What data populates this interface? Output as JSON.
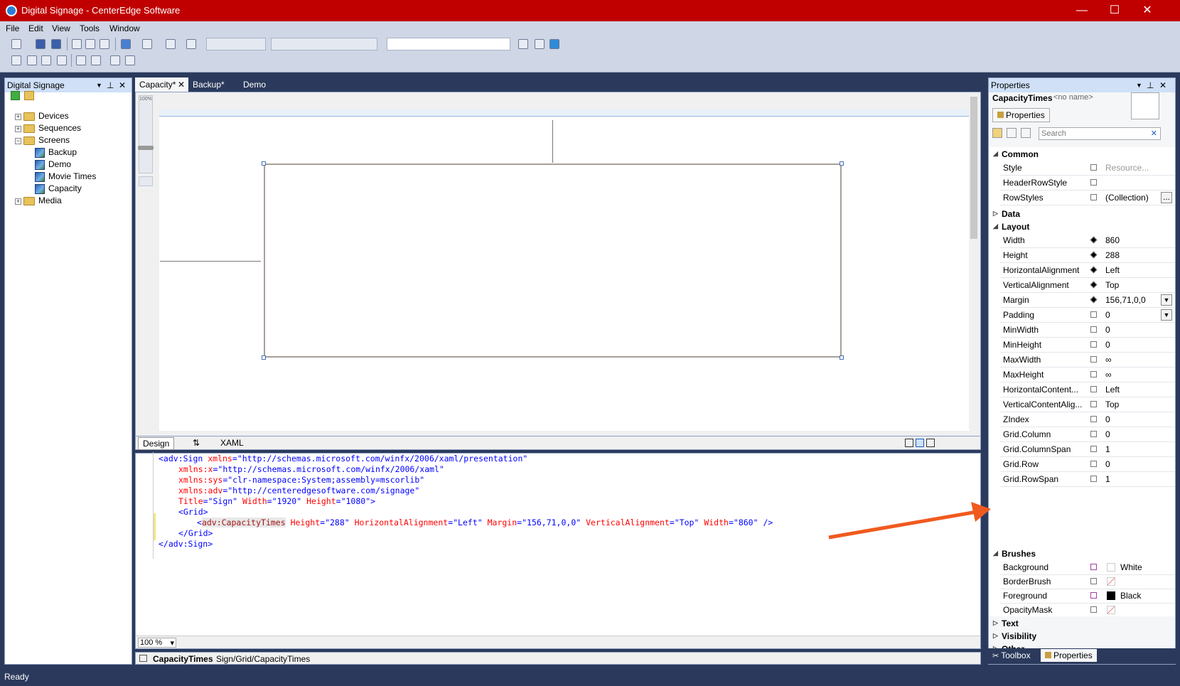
{
  "window": {
    "title": "Digital Signage - CenterEdge Software",
    "min_glyph": "—",
    "max_glyph": "☐",
    "close_glyph": "✕"
  },
  "menu": [
    "File",
    "Edit",
    "View",
    "Tools",
    "Window"
  ],
  "left_panel": {
    "title": "Digital Signage",
    "tree": [
      {
        "label": "Devices",
        "expander": "+"
      },
      {
        "label": "Sequences",
        "expander": "+"
      },
      {
        "label": "Screens",
        "expander": "−"
      },
      {
        "label": "Backup"
      },
      {
        "label": "Demo"
      },
      {
        "label": "Movie Times"
      },
      {
        "label": "Capacity"
      },
      {
        "label": "Media",
        "expander": "+"
      }
    ]
  },
  "tabs": [
    {
      "label": "Capacity*",
      "close": "✕"
    },
    {
      "label": "Backup*"
    },
    {
      "label": "Demo"
    }
  ],
  "designer": {
    "zoom_chip": "100%"
  },
  "editor_tabs": {
    "design": "Design",
    "swap": "⇅",
    "xaml": "XAML"
  },
  "xaml": {
    "line1": {
      "tag": "<adv:Sign",
      "attr": "xmlns",
      "eq": "=",
      "val": "\"http://schemas.microsoft.com/winfx/2006/xaml/presentation\""
    },
    "line2": {
      "attr": "xmlns:x",
      "eq": "=",
      "val": "\"http://schemas.microsoft.com/winfx/2006/xaml\""
    },
    "line3": {
      "attr": "xmlns:sys",
      "eq": "=",
      "val": "\"clr-namespace:System;assembly=mscorlib\""
    },
    "line4": {
      "attr": "xmlns:adv",
      "eq": "=",
      "val": "\"http://centeredgesoftware.com/signage\""
    },
    "line5": {
      "attr1": "Title",
      "val1": "\"Sign\"",
      "attr2": "Width",
      "val2": "\"1920\"",
      "attr3": "Height",
      "val3": "\"1080\"",
      "close": ">"
    },
    "line6": {
      "tag": "<Grid>"
    },
    "line7": {
      "open": "<",
      "tag": "adv:CapacityTimes",
      "a1": "Height",
      "v1": "\"288\"",
      "a2": "HorizontalAlignment",
      "v2": "\"Left\"",
      "a3": "Margin",
      "v3": "\"156,71,0,0\"",
      "a4": "VerticalAlignment",
      "v4": "\"Top\"",
      "a5": "Width",
      "v5": "\"860\"",
      "close": " />"
    },
    "line8": {
      "tag": "</Grid>"
    },
    "line9": {
      "tag": "</adv:Sign>"
    }
  },
  "zoom": {
    "value": "100 %",
    "arrow": "▾"
  },
  "breadcrumb": {
    "element": "CapacityTimes",
    "path": "Sign/Grid/CapacityTimes"
  },
  "properties": {
    "title": "Properties",
    "element_name": "CapacityTimes",
    "no_name": "<no name>",
    "properties_button": "Properties",
    "search_placeholder": "Search",
    "search_clear": "✕",
    "categories": {
      "common": "Common",
      "data": "Data",
      "layout": "Layout",
      "brushes": "Brushes",
      "text": "Text",
      "visibility": "Visibility",
      "other": "Other"
    },
    "common": [
      {
        "name": "Style",
        "value": "Resource..."
      },
      {
        "name": "HeaderRowStyle",
        "value": ""
      },
      {
        "name": "RowStyles",
        "value": "(Collection)",
        "button": "..."
      }
    ],
    "layout": [
      {
        "name": "Width",
        "value": "860"
      },
      {
        "name": "Height",
        "value": "288"
      },
      {
        "name": "HorizontalAlignment",
        "value": "Left"
      },
      {
        "name": "VerticalAlignment",
        "value": "Top"
      },
      {
        "name": "Margin",
        "value": "156,71,0,0"
      },
      {
        "name": "Padding",
        "value": "0"
      },
      {
        "name": "MinWidth",
        "value": "0"
      },
      {
        "name": "MinHeight",
        "value": "0"
      },
      {
        "name": "MaxWidth",
        "value": "∞"
      },
      {
        "name": "MaxHeight",
        "value": "∞"
      },
      {
        "name": "HorizontalContent...",
        "value": "Left"
      },
      {
        "name": "VerticalContentAlig...",
        "value": "Top"
      },
      {
        "name": "ZIndex",
        "value": "0"
      },
      {
        "name": "Grid.Column",
        "value": "0"
      },
      {
        "name": "Grid.ColumnSpan",
        "value": "1"
      },
      {
        "name": "Grid.Row",
        "value": "0"
      },
      {
        "name": "Grid.RowSpan",
        "value": "1"
      }
    ],
    "brushes": [
      {
        "name": "Background",
        "value": "White",
        "swatch": "#ffffff"
      },
      {
        "name": "BorderBrush",
        "value": ""
      },
      {
        "name": "Foreground",
        "value": "Black",
        "swatch": "#000000"
      },
      {
        "name": "OpacityMask",
        "value": ""
      }
    ]
  },
  "bottom_tabs": {
    "toolbox": "Toolbox",
    "properties": "Properties"
  },
  "status": {
    "text": "Ready"
  },
  "colors": {
    "title_bar": "#c00000",
    "frame": "#2b3a5c",
    "annotation_arrow": "#f05a1e"
  }
}
